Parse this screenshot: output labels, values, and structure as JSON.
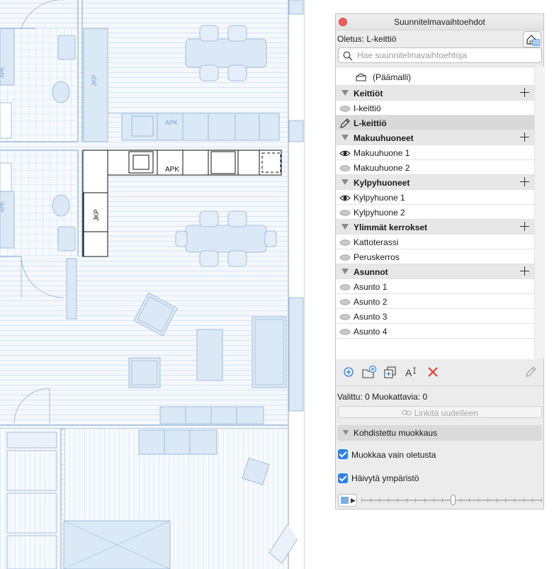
{
  "plan": {
    "labels": {
      "apk_top": "APK",
      "apk_main": "APK",
      "jkp": "JKP",
      "apk_left1": "APK",
      "apk_left2": "APK"
    }
  },
  "panel": {
    "title": "Suunnitelmavaihtoehdot",
    "default_label": "Oletus: L-keittiö",
    "search_placeholder": "Hae suunnitelmavaihtoehtoja",
    "master_label": "(Päämalli)",
    "rows": [
      {
        "label": "Keittiöt",
        "kind": "group"
      },
      {
        "label": "I-keittiö",
        "kind": "item",
        "state": "hidden"
      },
      {
        "label": "L-keittiö",
        "kind": "item",
        "state": "editing"
      },
      {
        "label": "Makuuhuoneet",
        "kind": "group"
      },
      {
        "label": "Makuuhuone 1",
        "kind": "item",
        "state": "visible"
      },
      {
        "label": "Makuuhuone 2",
        "kind": "item",
        "state": "hidden"
      },
      {
        "label": "Kylpyhuoneet",
        "kind": "group"
      },
      {
        "label": "Kylpyhuone 1",
        "kind": "item",
        "state": "visible"
      },
      {
        "label": "Kylpyhuone 2",
        "kind": "item",
        "state": "hidden"
      },
      {
        "label": "Ylimmät kerrokset",
        "kind": "group"
      },
      {
        "label": "Kattoterassi",
        "kind": "item",
        "state": "hidden"
      },
      {
        "label": "Peruskerros",
        "kind": "item",
        "state": "hidden"
      },
      {
        "label": "Asunnot",
        "kind": "group"
      },
      {
        "label": "Asunto 1",
        "kind": "item",
        "state": "hidden"
      },
      {
        "label": "Asunto 2",
        "kind": "item",
        "state": "hidden"
      },
      {
        "label": "Asunto 3",
        "kind": "item",
        "state": "hidden"
      },
      {
        "label": "Asunto 4",
        "kind": "item",
        "state": "hidden"
      }
    ],
    "toolbar_icons": [
      "add-option-icon",
      "add-folder-icon",
      "duplicate-icon",
      "rename-icon",
      "delete-icon",
      "edit-pencil-icon"
    ],
    "status": "Valittu: 0 Muokattavia: 0",
    "relink_label": "Linkitä uudelleen",
    "focus_header": "Kohdistettu muokkaus",
    "edit_only_default": "Muokkaa vain oletusta",
    "fade_surroundings": "Häivytä ympäristö",
    "fade_color": "#7ab0e6",
    "fade_level": 0.51
  }
}
